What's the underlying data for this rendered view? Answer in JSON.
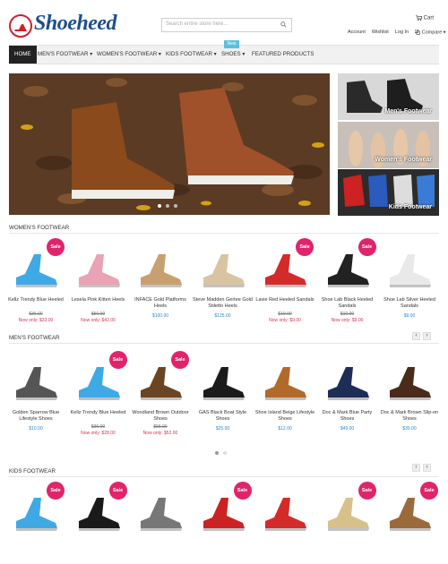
{
  "header": {
    "logo_text": "Shoeheed",
    "search_placeholder": "Search entire store here...",
    "cart_label": "Cart",
    "links": [
      "Account",
      "Wishlist",
      "Log In",
      "Compare"
    ]
  },
  "nav": {
    "items": [
      "HOME",
      "MEN'S FOOTWEAR",
      "WOMEN'S FOOTWEAR",
      "KIDS FOOTWEAR",
      "SHOES",
      "FEATURED PRODUCTS"
    ],
    "new_badge": "New"
  },
  "side_banners": [
    "Men's Footwear",
    "Women's Footwear",
    "Kids Footwear"
  ],
  "sections": {
    "womens": {
      "title": "WOMEN'S FOOTWEAR",
      "products": [
        {
          "name": "Kellz Trendy Blue Heeled",
          "old_price": "$36.00",
          "new_price": "Now only: $33.00",
          "price": "",
          "sale": "Sale"
        },
        {
          "name": "Lesela Pink Kitten Heels",
          "old_price": "$50.00",
          "new_price": "Now only: $42.00",
          "price": "",
          "sale": ""
        },
        {
          "name": "INFACE Gold Platforms Heels",
          "old_price": "",
          "new_price": "",
          "price": "$100.00",
          "sale": ""
        },
        {
          "name": "Steve Madden Gertee Gold Stiletto Heels",
          "old_price": "",
          "new_price": "",
          "price": "$125.00",
          "sale": ""
        },
        {
          "name": "Lavie Red Heeled Sandals",
          "old_price": "$10.00",
          "new_price": "Now only: $9.00",
          "price": "",
          "sale": "Sale"
        },
        {
          "name": "Shoe Lab Black Heeled Sandals",
          "old_price": "$10.00",
          "new_price": "Now only: $9.00",
          "price": "",
          "sale": "Sale"
        },
        {
          "name": "Shoe Lab Silver Heeled Sandals",
          "old_price": "",
          "new_price": "",
          "price": "$9.00",
          "sale": ""
        }
      ]
    },
    "mens": {
      "title": "MEN'S FOOTWEAR",
      "products": [
        {
          "name": "Golden Sparrow Blue Lifestyle Shoes",
          "old_price": "",
          "new_price": "",
          "price": "$10.00",
          "sale": ""
        },
        {
          "name": "Kellz Trendy Blue Heeled",
          "old_price": "$36.00",
          "new_price": "Now only: $28.00",
          "price": "",
          "sale": "Sale"
        },
        {
          "name": "Woodland Brown Outdoor Shoes",
          "old_price": "$55.00",
          "new_price": "Now only: $52.00",
          "price": "",
          "sale": "Sale"
        },
        {
          "name": "GAS Black Boat Style Shoes",
          "old_price": "",
          "new_price": "",
          "price": "$25.00",
          "sale": ""
        },
        {
          "name": "Shoe Island Beige Lifestyle Shoes",
          "old_price": "",
          "new_price": "",
          "price": "$12.00",
          "sale": ""
        },
        {
          "name": "Doc & Mark Blue Party Shoes",
          "old_price": "",
          "new_price": "",
          "price": "$49.00",
          "sale": ""
        },
        {
          "name": "Doc & Mark Brown Slip-on Shoes",
          "old_price": "",
          "new_price": "",
          "price": "$39.00",
          "sale": ""
        }
      ]
    },
    "kids": {
      "title": "KIDS FOOTWEAR",
      "products": [
        {
          "sale": "Sale"
        },
        {
          "sale": "Sale"
        },
        {
          "sale": ""
        },
        {
          "sale": "Sale"
        },
        {
          "sale": ""
        },
        {
          "sale": "Sale"
        },
        {
          "sale": "Sale"
        }
      ]
    }
  },
  "colors": {
    "accent": "#e0246b",
    "brand": "#1d4f8c",
    "price": "#2a8ac8",
    "sale_price": "#d9304f"
  }
}
